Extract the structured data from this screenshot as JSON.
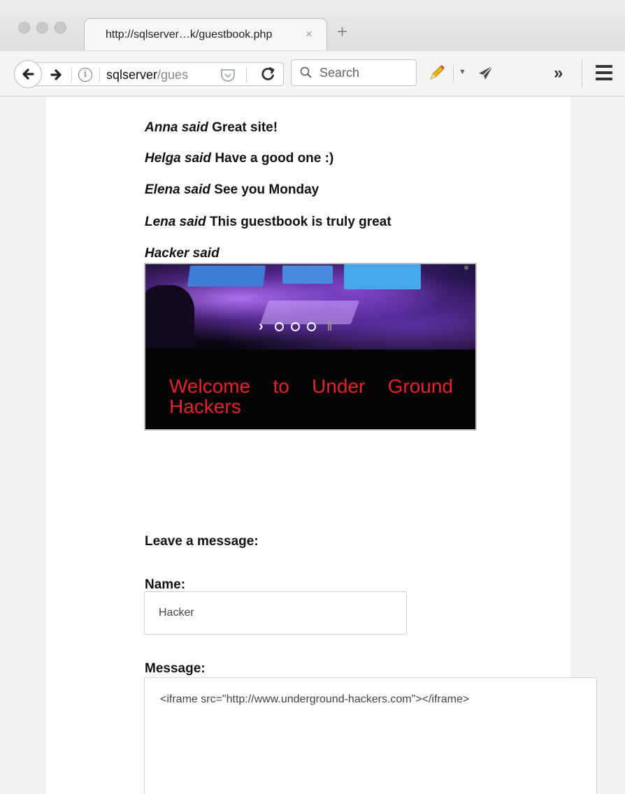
{
  "browser": {
    "tab_title": "http://sqlserver…k/guestbook.php",
    "tab_close": "×",
    "new_tab": "+",
    "url_host": "sqlserver",
    "url_path": "/gues",
    "search_placeholder": "Search",
    "overflow": "»"
  },
  "guestbook": {
    "posts": [
      {
        "author": "Anna said",
        "message": "Great site!"
      },
      {
        "author": "Helga said",
        "message": "Have a good one :)"
      },
      {
        "author": "Elena said",
        "message": "See you Monday"
      },
      {
        "author": "Lena said",
        "message": "This guestbook is truly great"
      },
      {
        "author": "Hacker said",
        "message": ""
      }
    ],
    "embed_banner": "Welcome to Under Ground Hackers",
    "slider_next": "›",
    "slider_pause": "II"
  },
  "form": {
    "heading": "Leave a message:",
    "name_label": "Name:",
    "name_value": "Hacker",
    "message_label": "Message:",
    "message_value": "<iframe src=\"http://www.underground-hackers.com\"></iframe>"
  }
}
